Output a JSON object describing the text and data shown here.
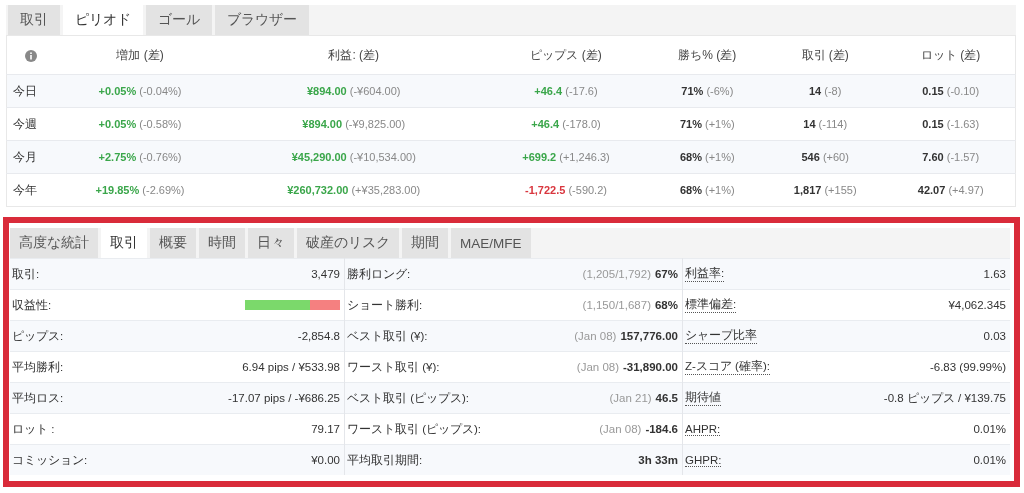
{
  "period_tabs": [
    {
      "label": "取引",
      "selected": false
    },
    {
      "label": "ピリオド",
      "selected": true
    },
    {
      "label": "ゴール",
      "selected": false
    },
    {
      "label": "ブラウザー",
      "selected": false
    }
  ],
  "period_table": {
    "columns": [
      "増加 (差)",
      "利益: (差)",
      "ピップス (差)",
      "勝ち% (差)",
      "取引 (差)",
      "ロット (差)"
    ],
    "rows": [
      {
        "label": "今日",
        "cells": [
          {
            "value": "+0.05%",
            "color": "#3aa64a",
            "diff": "(-0.04%)"
          },
          {
            "value": "¥894.00",
            "color": "#3aa64a",
            "diff": "(-¥604.00)"
          },
          {
            "value": "+46.4",
            "color": "#3aa64a",
            "diff": "(-17.6)"
          },
          {
            "value": "71%",
            "color": "#333333",
            "diff": "(-6%)"
          },
          {
            "value": "14",
            "color": "#333333",
            "diff": "(-8)"
          },
          {
            "value": "0.15",
            "color": "#333333",
            "diff": "(-0.10)"
          }
        ]
      },
      {
        "label": "今週",
        "cells": [
          {
            "value": "+0.05%",
            "color": "#3aa64a",
            "diff": "(-0.58%)"
          },
          {
            "value": "¥894.00",
            "color": "#3aa64a",
            "diff": "(-¥9,825.00)"
          },
          {
            "value": "+46.4",
            "color": "#3aa64a",
            "diff": "(-178.0)"
          },
          {
            "value": "71%",
            "color": "#333333",
            "diff": "(+1%)"
          },
          {
            "value": "14",
            "color": "#333333",
            "diff": "(-114)"
          },
          {
            "value": "0.15",
            "color": "#333333",
            "diff": "(-1.63)"
          }
        ]
      },
      {
        "label": "今月",
        "cells": [
          {
            "value": "+2.75%",
            "color": "#3aa64a",
            "diff": "(-0.76%)"
          },
          {
            "value": "¥45,290.00",
            "color": "#3aa64a",
            "diff": "(-¥10,534.00)"
          },
          {
            "value": "+699.2",
            "color": "#3aa64a",
            "diff": "(+1,246.3)"
          },
          {
            "value": "68%",
            "color": "#333333",
            "diff": "(+1%)"
          },
          {
            "value": "546",
            "color": "#333333",
            "diff": "(+60)"
          },
          {
            "value": "7.60",
            "color": "#333333",
            "diff": "(-1.57)"
          }
        ]
      },
      {
        "label": "今年",
        "cells": [
          {
            "value": "+19.85%",
            "color": "#3aa64a",
            "diff": "(-2.69%)"
          },
          {
            "value": "¥260,732.00",
            "color": "#3aa64a",
            "diff": "(+¥35,283.00)"
          },
          {
            "value": "-1,722.5",
            "color": "#d9363e",
            "diff": "(-590.2)"
          },
          {
            "value": "68%",
            "color": "#333333",
            "diff": "(+1%)"
          },
          {
            "value": "1,817",
            "color": "#333333",
            "diff": "(+155)"
          },
          {
            "value": "42.07",
            "color": "#333333",
            "diff": "(+4.97)"
          }
        ]
      }
    ]
  },
  "stats_tabs": [
    {
      "label": "高度な統計",
      "selected": false
    },
    {
      "label": "取引",
      "selected": true
    },
    {
      "label": "概要",
      "selected": false
    },
    {
      "label": "時間",
      "selected": false
    },
    {
      "label": "日々",
      "selected": false
    },
    {
      "label": "破産のリスク",
      "selected": false
    },
    {
      "label": "期間",
      "selected": false
    },
    {
      "label": "MAE/MFE",
      "selected": false
    }
  ],
  "stats_columns": [
    {
      "dotted_labels": false,
      "rows": [
        {
          "kind": "text",
          "label": "取引:",
          "value": "3,479"
        },
        {
          "kind": "bar",
          "label": "収益性:",
          "level": 0.68
        },
        {
          "kind": "text",
          "label": "ピップス:",
          "value": "-2,854.8"
        },
        {
          "kind": "text",
          "label": "平均勝利:",
          "value": "6.94 pips / ¥533.98"
        },
        {
          "kind": "text",
          "label": "平均ロス:",
          "value": "-17.07 pips / -¥686.25"
        },
        {
          "kind": "text",
          "label": "ロット :",
          "value": "79.17"
        },
        {
          "kind": "text",
          "label": "コミッション:",
          "value": "¥0.00"
        }
      ]
    },
    {
      "dotted_labels": false,
      "rows": [
        {
          "kind": "text",
          "label": "勝利ロング:",
          "note": "(1,205/1,792)",
          "value": "67%"
        },
        {
          "kind": "text",
          "label": "ショート勝利:",
          "note": "(1,150/1,687)",
          "value": "68%"
        },
        {
          "kind": "text",
          "label": "ベスト取引 (¥):",
          "note": "(Jan 08)",
          "value": "157,776.00"
        },
        {
          "kind": "text",
          "label": "ワースト取引 (¥):",
          "note": "(Jan 08)",
          "value": "-31,890.00"
        },
        {
          "kind": "text",
          "label": "ベスト取引 (ピップス):",
          "note": "(Jan 21)",
          "value": "46.5"
        },
        {
          "kind": "text",
          "label": "ワースト取引 (ピップス):",
          "note": "(Jan 08)",
          "value": "-184.6"
        },
        {
          "kind": "text",
          "label": "平均取引期間:",
          "value": "3h 33m"
        }
      ]
    },
    {
      "dotted_labels": true,
      "rows": [
        {
          "kind": "text",
          "label": "利益率:",
          "value": "1.63"
        },
        {
          "kind": "text",
          "label": "標準偏差:",
          "value": "¥4,062.345"
        },
        {
          "kind": "text",
          "label": "シャープ比率",
          "value": "0.03"
        },
        {
          "kind": "text",
          "label": "Z-スコア (確率):",
          "value": "-6.83 (99.99%)"
        },
        {
          "kind": "text",
          "label": "期待値",
          "value": "-0.8 ピップス / ¥139.75"
        },
        {
          "kind": "text",
          "label": "AHPR:",
          "value": "0.01%"
        },
        {
          "kind": "text",
          "label": "GHPR:",
          "value": "0.01%"
        }
      ]
    }
  ]
}
